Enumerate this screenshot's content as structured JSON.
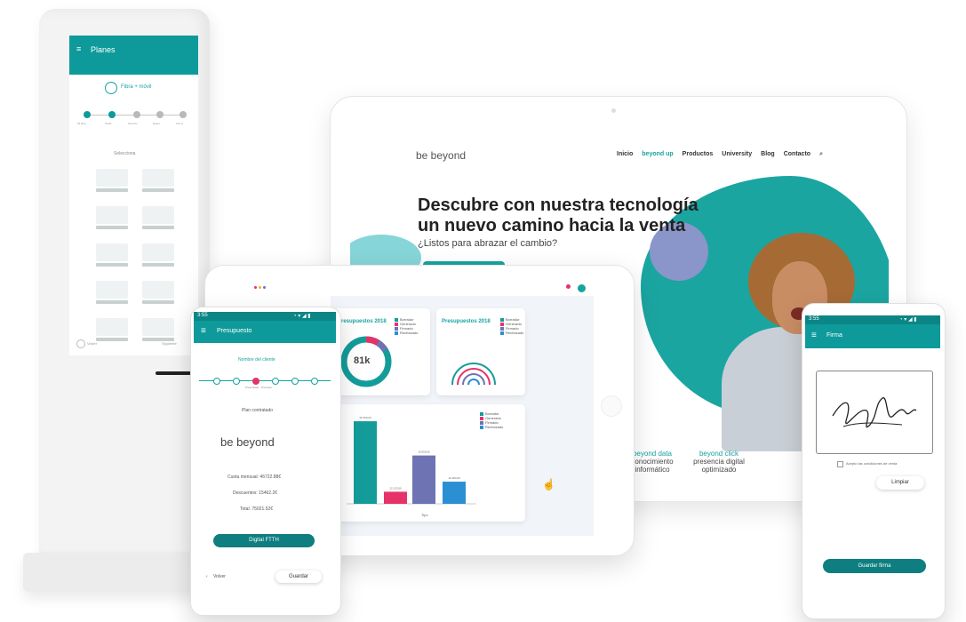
{
  "colors": {
    "teal": "#0e9a9a",
    "teal_dark": "#0b8585",
    "purple": "#6d73b3",
    "pink": "#e5336a",
    "blue": "#2b8fd3"
  },
  "kiosk": {
    "app_title": "Planes",
    "step_header": "Fibra + móvil",
    "steps": [
      "Mi fibra",
      "Tarifa",
      "Servicio",
      "Datos",
      "Firma"
    ],
    "select_prompt": "Selecciona",
    "footer_back": "Volver",
    "footer_next": "Siguiente"
  },
  "website": {
    "brand": "be beyond",
    "nav": [
      "Inicio",
      "beyond up",
      "Productos",
      "University",
      "Blog",
      "Contacto"
    ],
    "headline_line1": "Descubre con nuestra tecnología",
    "headline_line2": "un nuevo camino hacia la venta",
    "subheadline": "¿Listos para abrazar el cambio?",
    "features": [
      {
        "title": "beyond data",
        "text_line1": "conocimiento",
        "text_line2": "informático"
      },
      {
        "title": "beyond click",
        "text_line1": "presencia digital",
        "text_line2": "optimizado"
      }
    ]
  },
  "dashboard": {
    "card1_title": "Presupuestos 2018",
    "card1_value": "81k",
    "card2_title": "Presupuestos 2018",
    "legend": [
      "Borrador",
      "Generado",
      "Firmado",
      "Rechazado"
    ],
    "bar_xlabel": "Tipo",
    "bar_labels": [
      "41.000,00",
      "12.123,00",
      "15.000,00",
      "11.000,00"
    ]
  },
  "chart_data": {
    "type": "bar",
    "categories": [
      "Borrador",
      "Generado",
      "Firmado",
      "Rechazado"
    ],
    "values": [
      41000,
      6000,
      24000,
      11000
    ],
    "colors": [
      "#139c9a",
      "#e5336a",
      "#6d73b3",
      "#2b8fd3"
    ],
    "xlabel": "Tipo",
    "ylim": [
      0,
      45000
    ]
  },
  "phone_left": {
    "status_time": "3:55",
    "app_title": "Presupuesto",
    "client_name": "Nombre del cliente",
    "progress_label": "Presentado · Previsión",
    "plan_label": "Plan contratado",
    "brand": "be beyond",
    "line_cuota": "Cuota mensual: 46722.88€",
    "line_descuentos": "Descuentos: 15462.2€",
    "line_total": "Total: 75021.52€",
    "primary_button": "Digital FTTH",
    "back_label": "Volver",
    "save_button": "Guardar"
  },
  "phone_right": {
    "status_time": "3:55",
    "app_title": "Firma",
    "accept_label": "Acepto las condiciones de venta",
    "clear_button": "Limpiar",
    "save_button": "Guardar firma"
  }
}
